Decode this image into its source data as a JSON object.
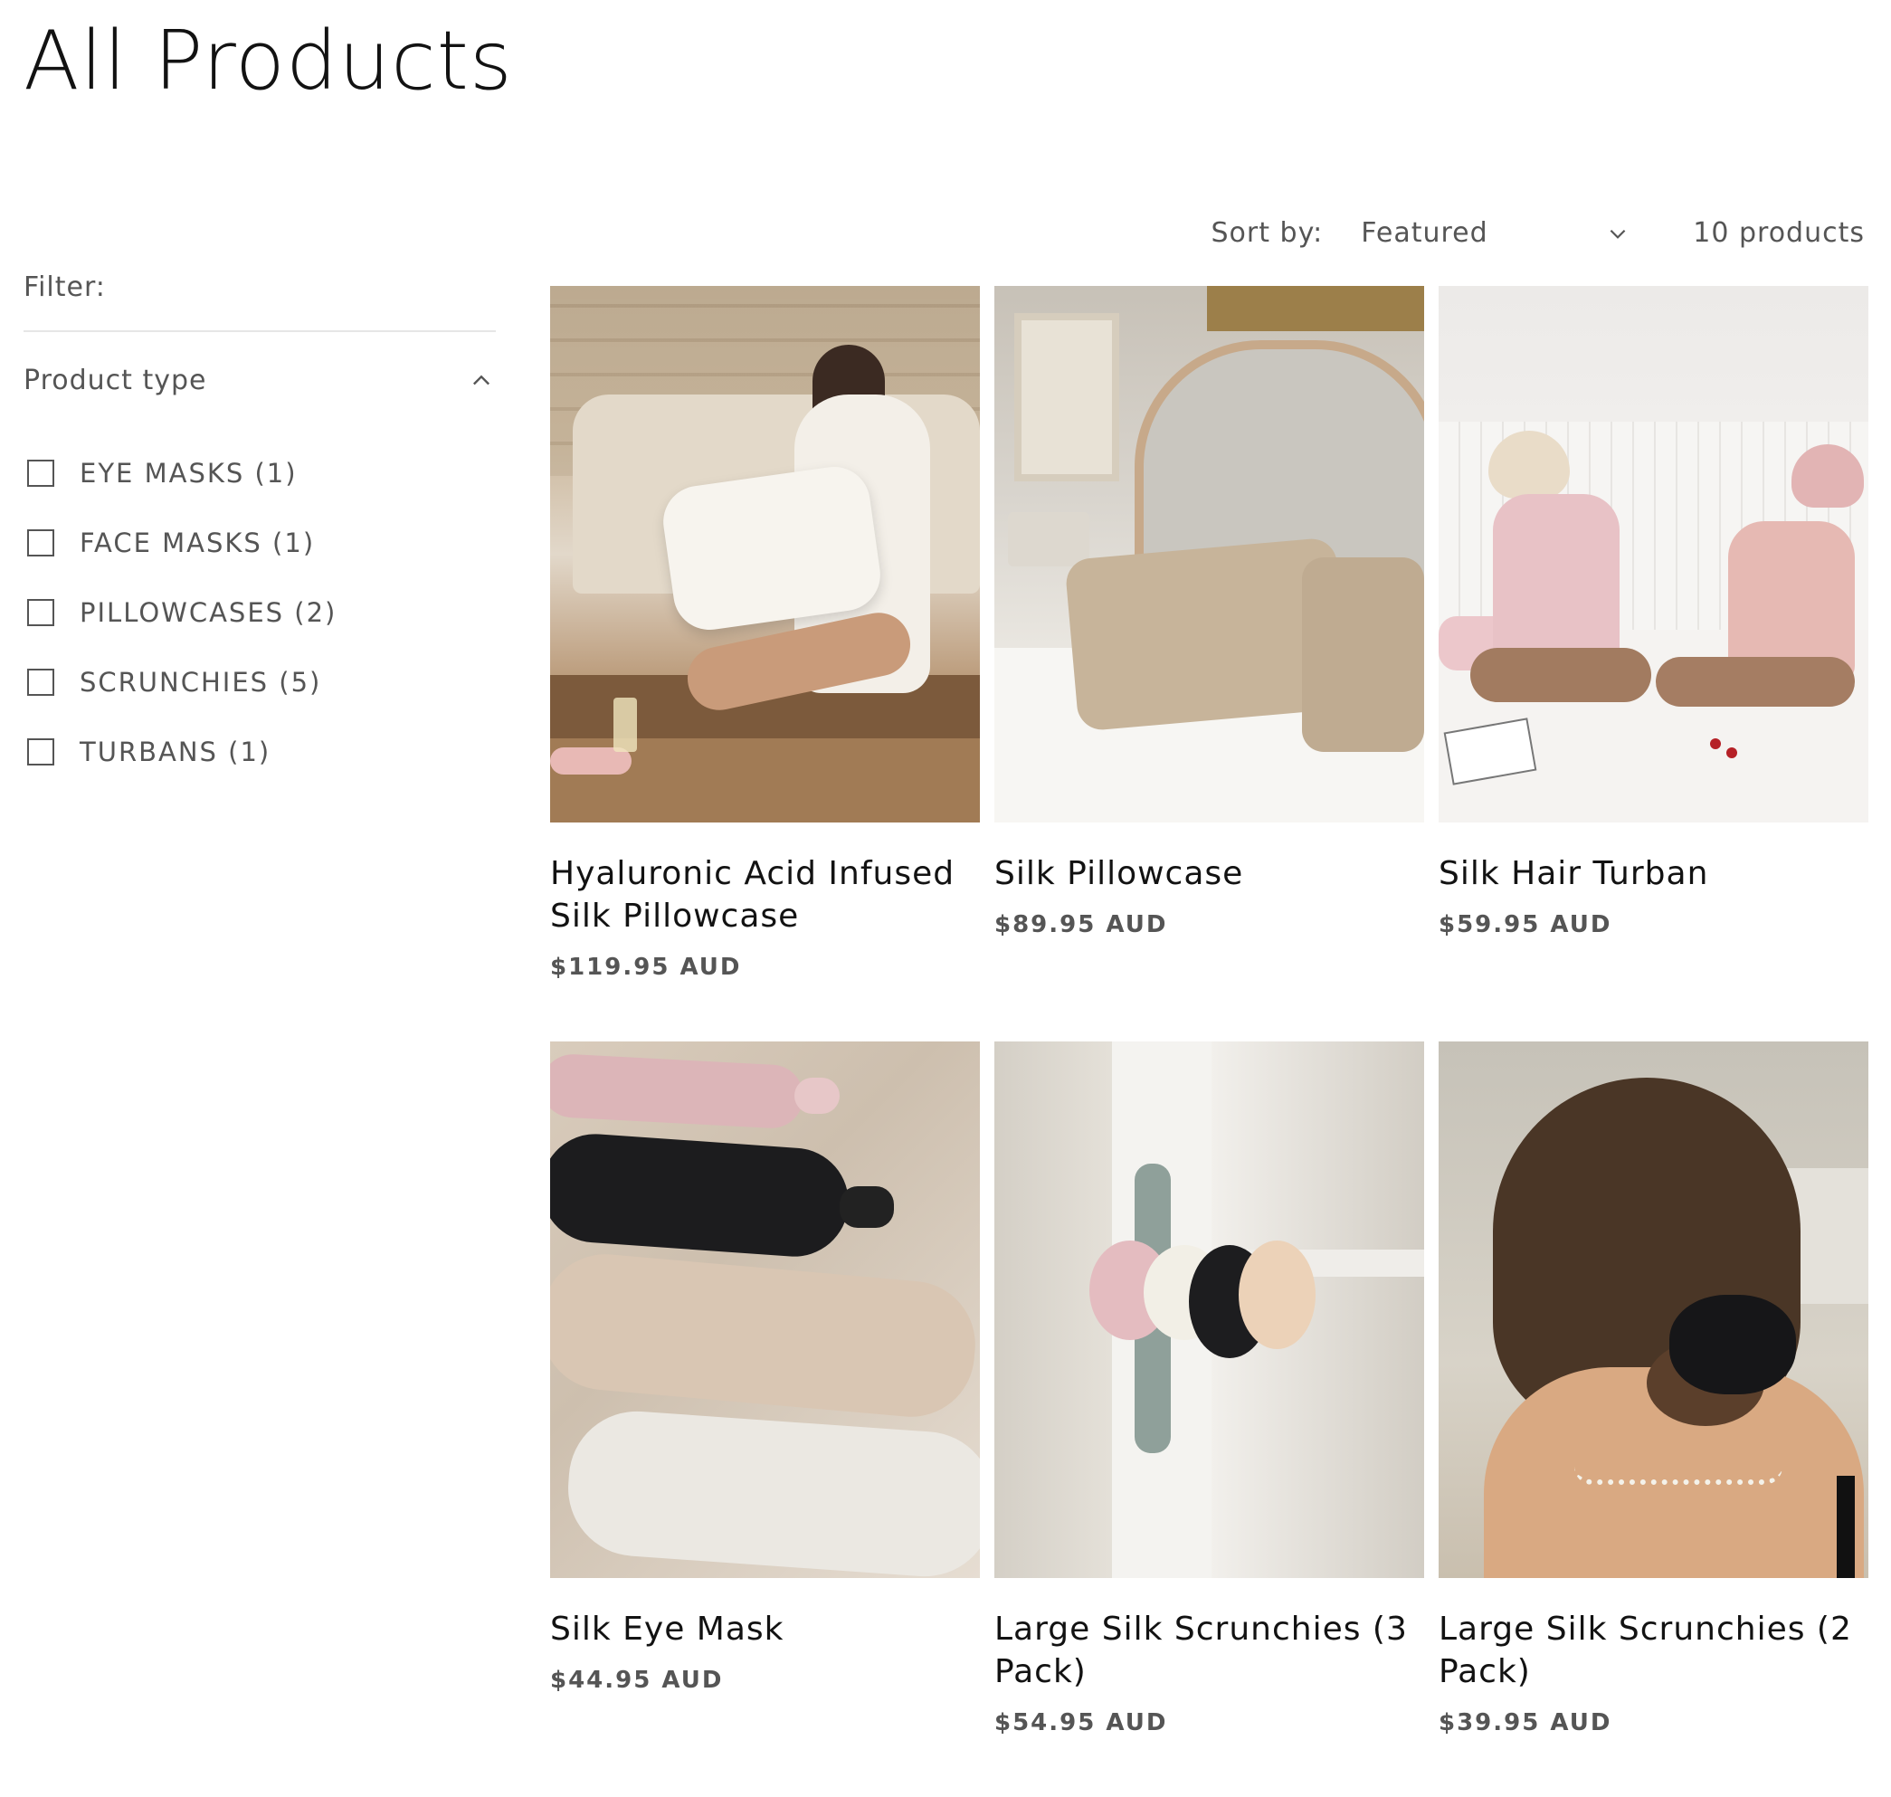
{
  "page": {
    "title": "All Products"
  },
  "sort": {
    "label": "Sort by:",
    "selected": "Featured",
    "count": "10 products"
  },
  "filter": {
    "heading": "Filter:",
    "facet": {
      "title": "Product type",
      "options": [
        {
          "label": "EYE MASKS (1)",
          "checked": false
        },
        {
          "label": "FACE MASKS (1)",
          "checked": false
        },
        {
          "label": "PILLOWCASES (2)",
          "checked": false
        },
        {
          "label": "SCRUNCHIES (5)",
          "checked": false
        },
        {
          "label": "TURBANS (1)",
          "checked": false
        }
      ]
    }
  },
  "products": [
    {
      "title": "Hyaluronic Acid Infused Silk Pillowcase",
      "price": "$119.95 AUD"
    },
    {
      "title": "Silk Pillowcase",
      "price": "$89.95 AUD"
    },
    {
      "title": "Silk Hair Turban",
      "price": "$59.95 AUD"
    },
    {
      "title": "Silk Eye Mask",
      "price": "$44.95 AUD"
    },
    {
      "title": "Large Silk Scrunchies (3 Pack)",
      "price": "$54.95 AUD"
    },
    {
      "title": "Large Silk Scrunchies (2 Pack)",
      "price": "$39.95 AUD"
    }
  ],
  "colors": {
    "text": "#121212",
    "muted": "#555555",
    "divider": "#e6e6e6"
  },
  "icons": {
    "sort": "chevron-down-icon",
    "facet": "chevron-up-icon"
  }
}
